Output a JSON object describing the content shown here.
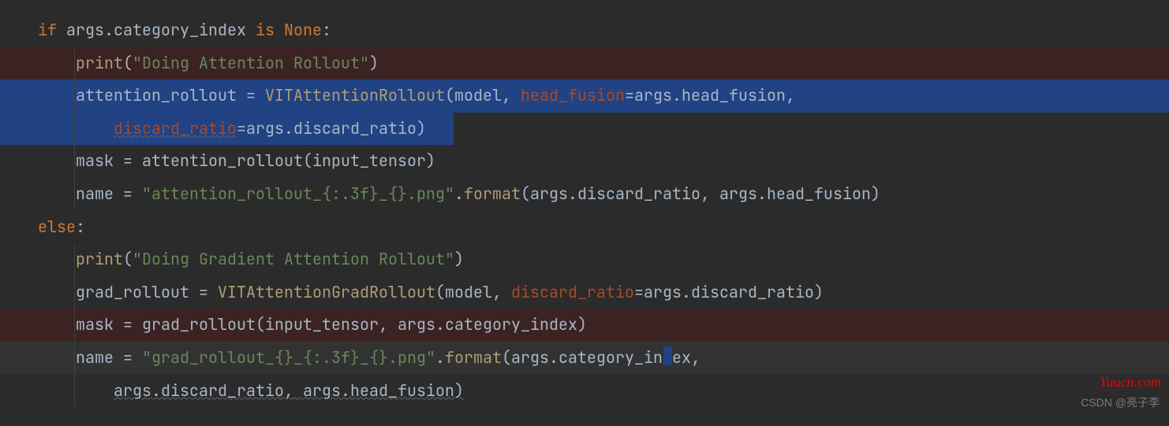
{
  "code": {
    "l1": {
      "kw_if": "if",
      "expr": " args.category_index ",
      "kw_is": "is",
      "sp": " ",
      "kw_none": "None",
      "colon": ":"
    },
    "l2": {
      "indent": "    ",
      "fn": "print",
      "open": "(",
      "str": "\"Doing Attention Rollout\"",
      "close": ")"
    },
    "l3": {
      "indent": "    ",
      "lhs": "attention_rollout = ",
      "ctor": "VITAttentionRollout",
      "open": "(",
      "a1": "model",
      "comma1": ", ",
      "p1": "head_fusion",
      "eq1": "=args.head_fusion",
      "comma2": ","
    },
    "l4": {
      "indent": "        ",
      "p1": "discard_ratio",
      "eq1": "=args.discard_ratio)",
      "close": ""
    },
    "l5": {
      "indent": "    ",
      "txt": "mask = attention_rollout(input_tensor)"
    },
    "l6": {
      "indent": "    ",
      "lhs": "name = ",
      "str": "\"attention_rollout_{:.3f}_{}.png\"",
      "dot": ".",
      "fn": "format",
      "args": "(args.discard_ratio, args.head_fusion)"
    },
    "l7": {
      "kw_else": "else",
      "colon": ":"
    },
    "l8": {
      "indent": "    ",
      "fn": "print",
      "open": "(",
      "str": "\"Doing Gradient Attention Rollout\"",
      "close": ")"
    },
    "l9": {
      "indent": "    ",
      "lhs": "grad_rollout = ",
      "ctor": "VITAttentionGradRollout",
      "open": "(",
      "a1": "model",
      "comma1": ", ",
      "p1": "discard_ratio",
      "eq1": "=args.discard_ratio)",
      "close": ""
    },
    "l10": {
      "indent": "    ",
      "txt": "mask = grad_rollout(input_tensor, args.category_index)"
    },
    "l11": {
      "indent": "    ",
      "lhs": "name = ",
      "str": "\"grad_rollout_{}_{:.3f}_{}.png\"",
      "dot": ".",
      "fn": "format",
      "open": "(",
      "a1a": "args.category_ind",
      "a1b": "ex",
      "comma": ","
    },
    "l12": {
      "indent": "        ",
      "txt": "args.discard_ratio, args.head_fusion)"
    }
  },
  "watermark": {
    "red": "Yuucn.com",
    "gray": "CSDN @亮子李"
  }
}
